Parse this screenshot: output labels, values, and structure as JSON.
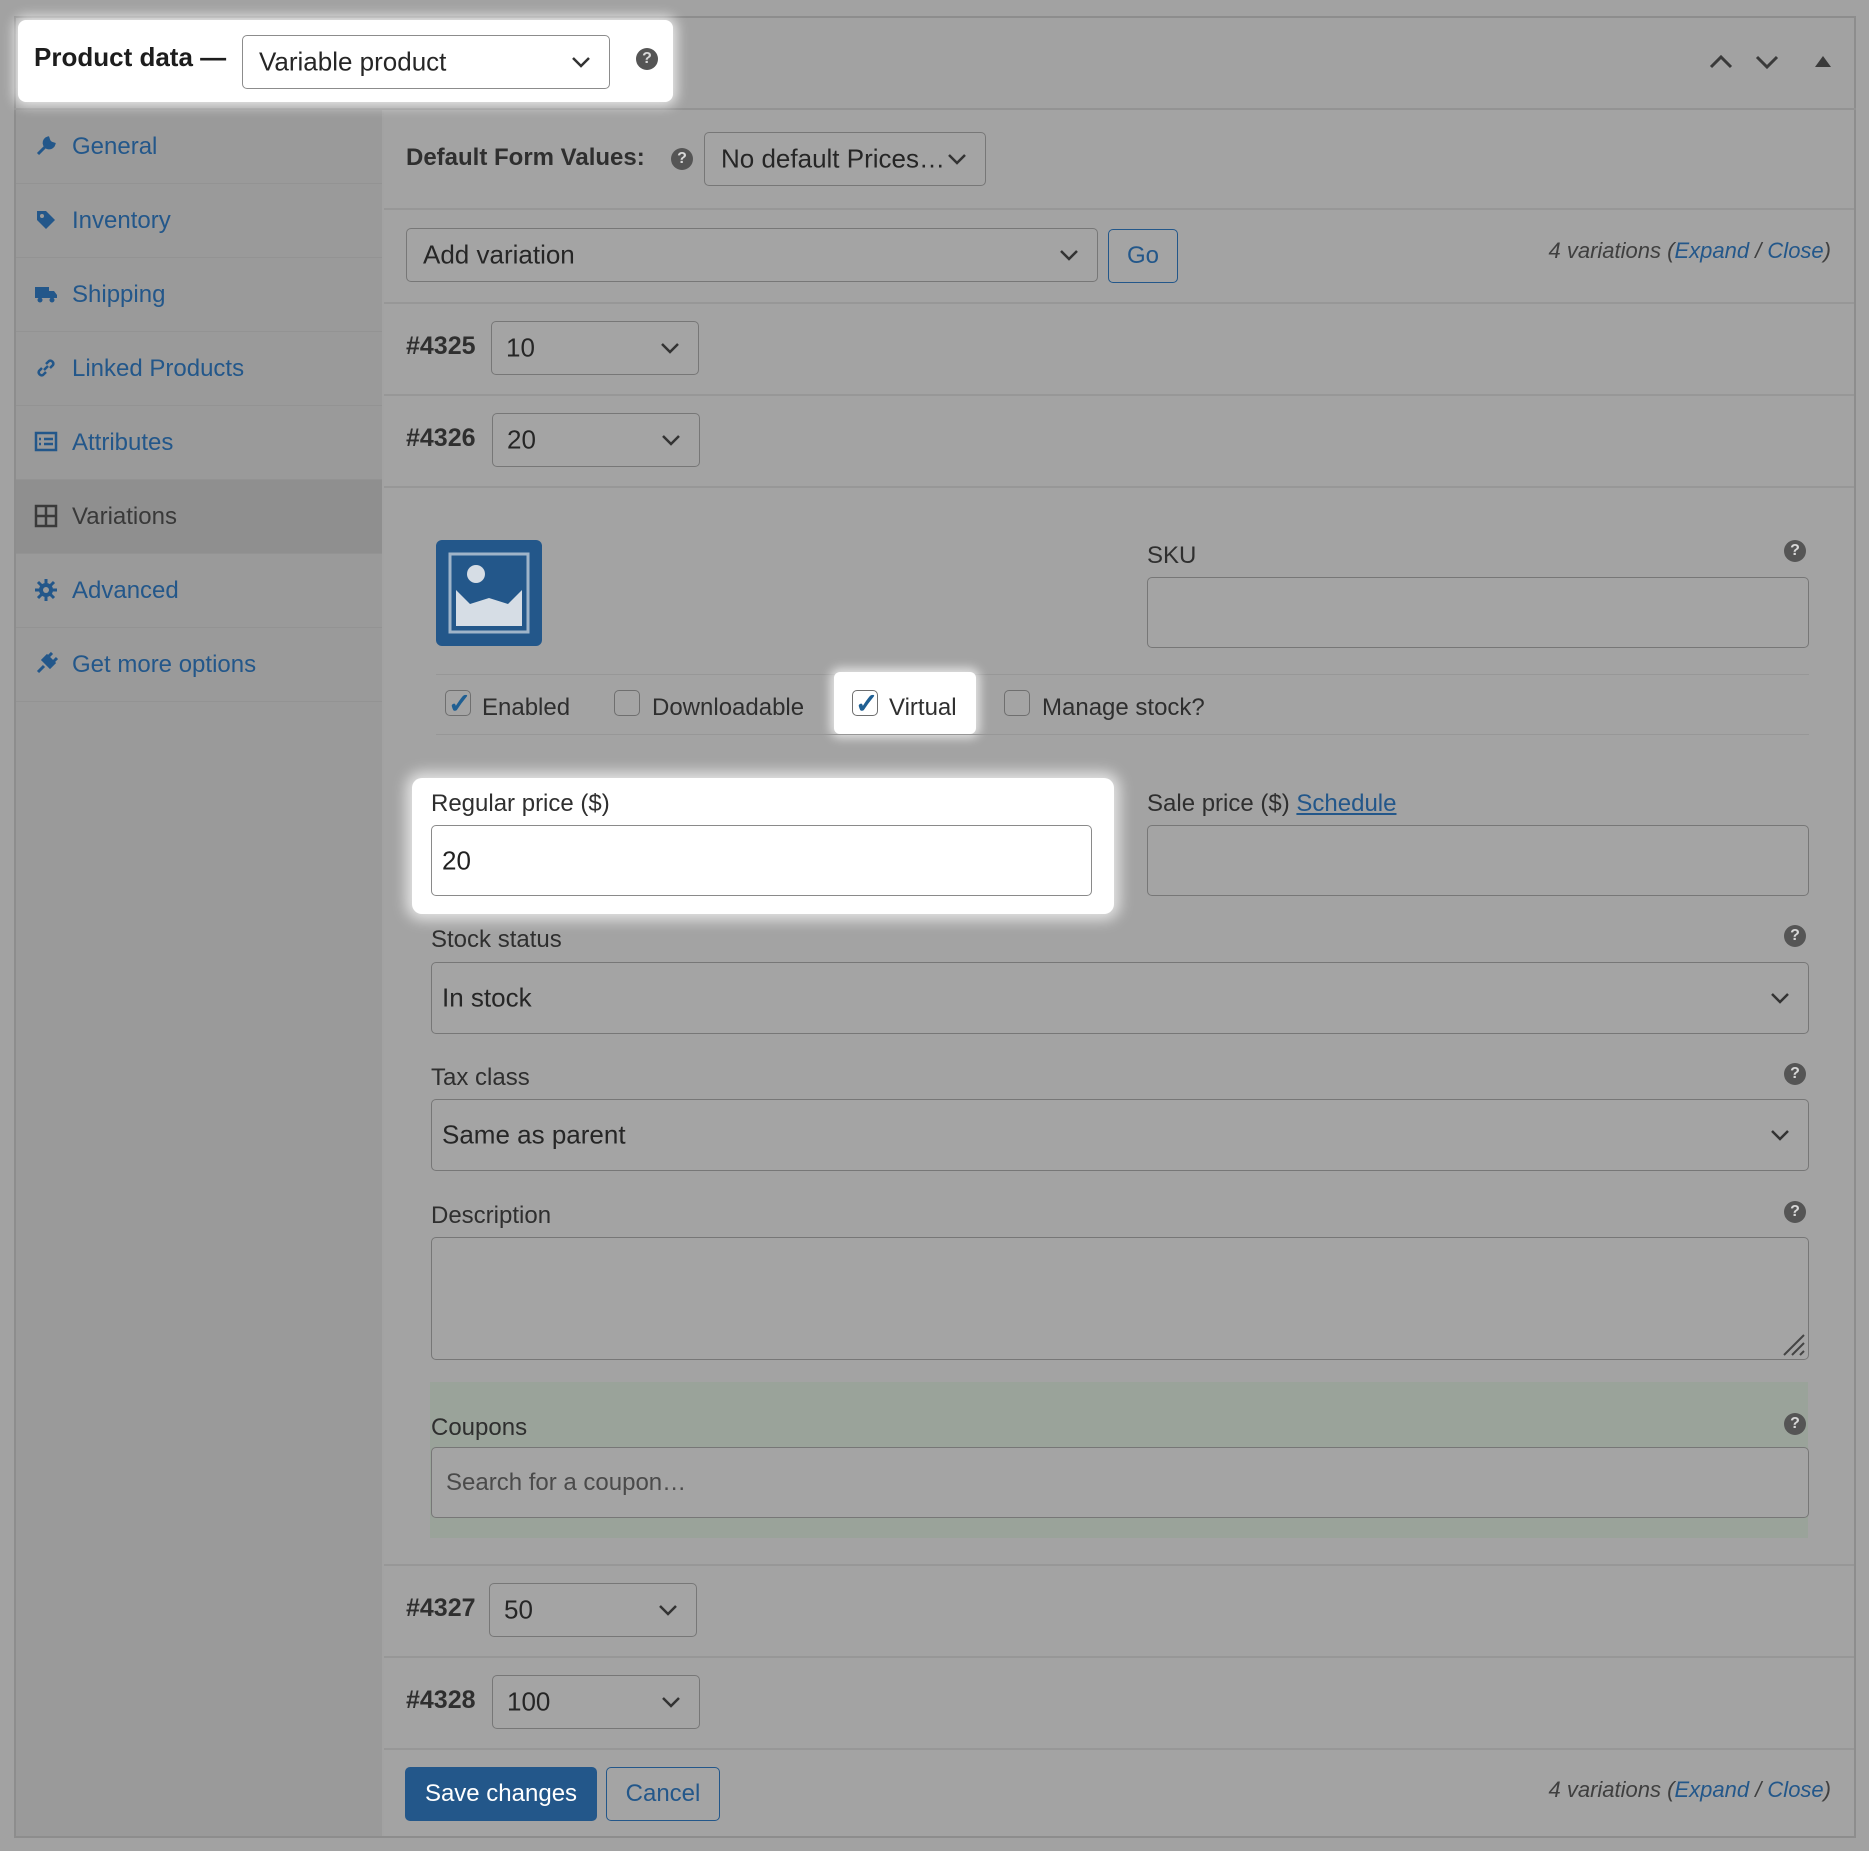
{
  "header": {
    "title": "Product data —",
    "product_type": "Variable product",
    "controls": [
      "chevron-up-icon",
      "chevron-down-icon",
      "triangle-up-icon"
    ]
  },
  "sidebar": {
    "items": [
      {
        "label": "General",
        "icon": "wrench-icon"
      },
      {
        "label": "Inventory",
        "icon": "tag-icon"
      },
      {
        "label": "Shipping",
        "icon": "truck-icon"
      },
      {
        "label": "Linked Products",
        "icon": "link-icon"
      },
      {
        "label": "Attributes",
        "icon": "list-icon"
      },
      {
        "label": "Variations",
        "icon": "grid-icon",
        "active": true
      },
      {
        "label": "Advanced",
        "icon": "gear-icon"
      },
      {
        "label": "Get more options",
        "icon": "plugin-icon"
      }
    ]
  },
  "defaults": {
    "label": "Default Form Values:",
    "value": "No default Prices…"
  },
  "toolbar": {
    "action_value": "Add variation",
    "go_label": "Go",
    "count_prefix": "4 variations (",
    "expand": "Expand",
    "sep": " / ",
    "close": "Close",
    "count_suffix": ")"
  },
  "variations": [
    {
      "id": "#4325",
      "value": "10"
    },
    {
      "id": "#4326",
      "value": "20"
    },
    {
      "id": "#4327",
      "value": "50"
    },
    {
      "id": "#4328",
      "value": "100"
    }
  ],
  "detail": {
    "image_icon": "image-placeholder-icon",
    "sku_label": "SKU",
    "sku_value": "",
    "checkboxes": [
      {
        "label": "Enabled",
        "checked": true
      },
      {
        "label": "Downloadable",
        "checked": false
      },
      {
        "label": "Virtual",
        "checked": true
      },
      {
        "label": "Manage stock?",
        "checked": false
      }
    ],
    "regular_price_label": "Regular price ($)",
    "regular_price_value": "20",
    "sale_price_label": "Sale price ($)",
    "schedule_link": "Schedule",
    "stock_status_label": "Stock status",
    "stock_status_value": "In stock",
    "tax_class_label": "Tax class",
    "tax_class_value": "Same as parent",
    "description_label": "Description",
    "coupons_label": "Coupons",
    "coupons_placeholder": "Search for a coupon…"
  },
  "footer": {
    "save_label": "Save changes",
    "cancel_label": "Cancel"
  },
  "colors": {
    "link": "#23578a",
    "overlay": "#a2a2a2",
    "highlight": "#ffffff"
  }
}
